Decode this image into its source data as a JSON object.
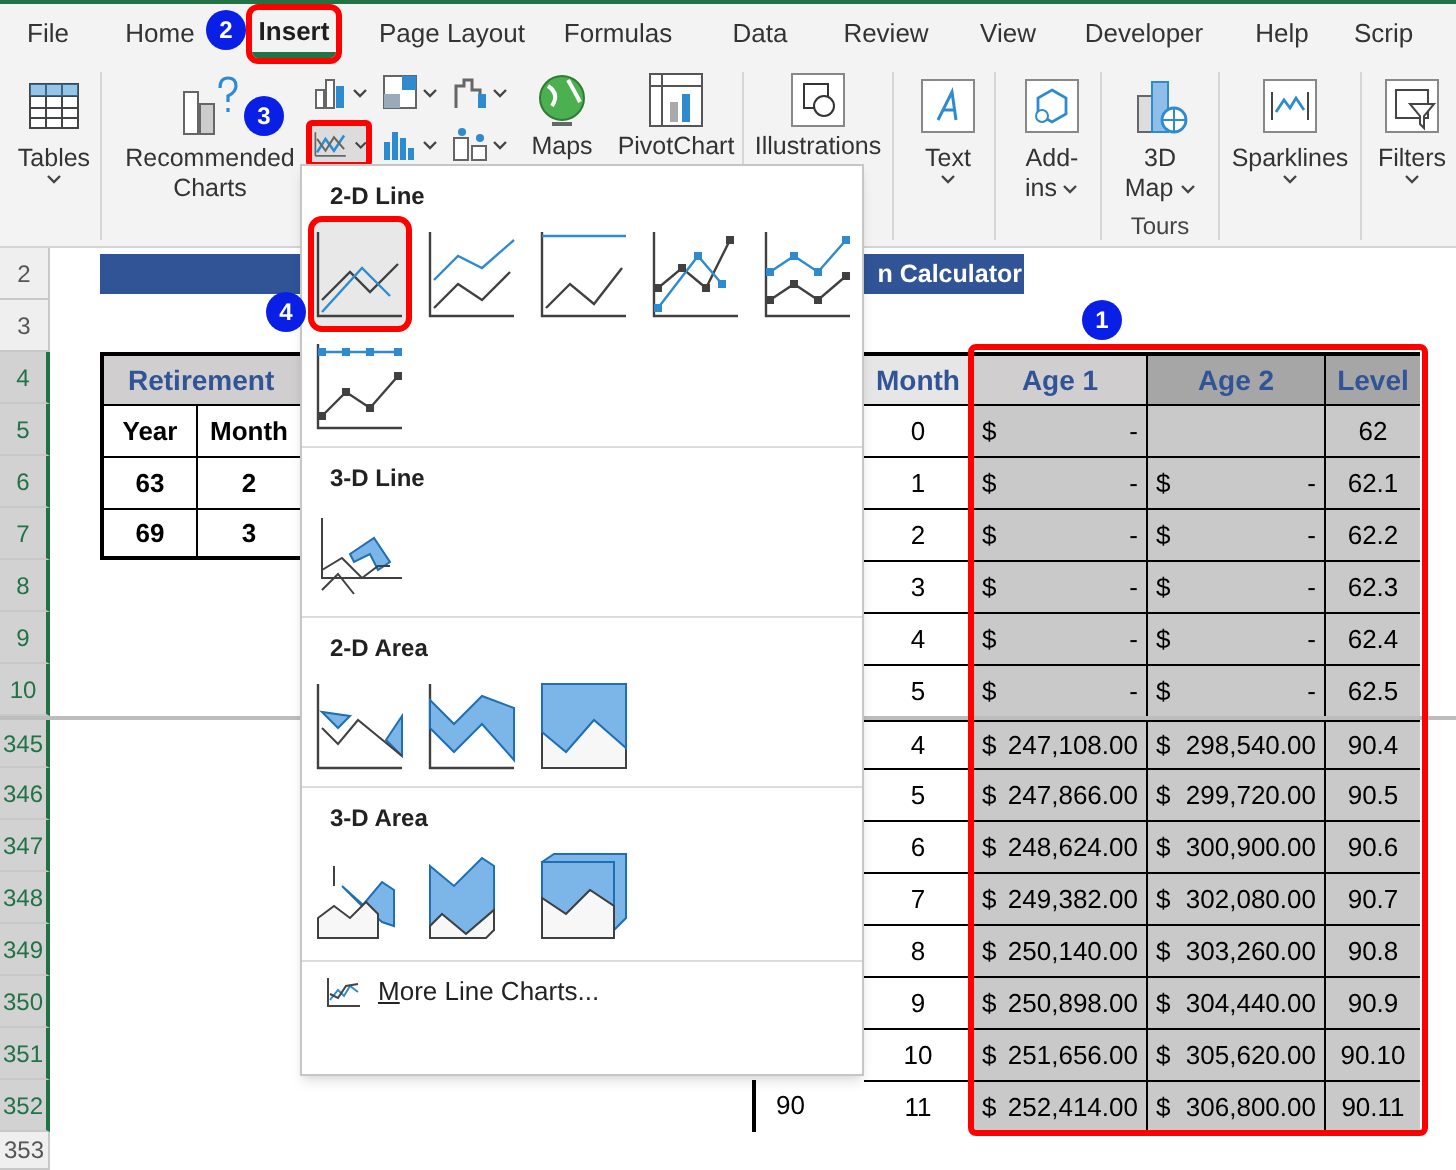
{
  "ribbon_tabs": [
    {
      "label": "File",
      "selected": false,
      "highlighted": false
    },
    {
      "label": "Home",
      "selected": false,
      "highlighted": false
    },
    {
      "label": "Insert",
      "selected": true,
      "highlighted": true
    },
    {
      "label": "Page Layout",
      "selected": false,
      "highlighted": false
    },
    {
      "label": "Formulas",
      "selected": false,
      "highlighted": false
    },
    {
      "label": "Data",
      "selected": false,
      "highlighted": false
    },
    {
      "label": "Review",
      "selected": false,
      "highlighted": false
    },
    {
      "label": "View",
      "selected": false,
      "highlighted": false
    },
    {
      "label": "Developer",
      "selected": false,
      "highlighted": false
    },
    {
      "label": "Help",
      "selected": false,
      "highlighted": false
    },
    {
      "label": "Scrip",
      "selected": false,
      "highlighted": false
    }
  ],
  "ribbon": {
    "tables": {
      "label": "Tables",
      "menu": true
    },
    "recommended_charts": {
      "lines": [
        "Recommended",
        "Charts"
      ]
    },
    "chart_buttons": [
      {
        "highlighted": false
      },
      {
        "highlighted": false
      },
      {
        "highlighted": false
      },
      {
        "highlighted": true
      },
      {
        "highlighted": false
      },
      {
        "highlighted": false
      }
    ],
    "maps": {
      "label": "Maps"
    },
    "pivot_chart": {
      "label": "PivotChart"
    },
    "illustrations": {
      "label": "Illustrations"
    },
    "text": {
      "label": "Text",
      "menu": true
    },
    "add_ins": {
      "lines": [
        "Add-",
        "ins"
      ],
      "menu": true
    },
    "map_3d": {
      "lines": [
        "3D",
        "Map"
      ],
      "menu": true
    },
    "tours_group": "Tours",
    "sparklines": {
      "label": "Sparklines",
      "menu": true
    },
    "filters": {
      "label": "Filters",
      "menu": true
    }
  },
  "sheet": {
    "row_headers": [
      {
        "label": "2",
        "selected": false
      },
      {
        "label": "3",
        "selected": false
      },
      {
        "label": "4",
        "selected": true
      },
      {
        "label": "5",
        "selected": true
      },
      {
        "label": "6",
        "selected": true
      },
      {
        "label": "7",
        "selected": true
      },
      {
        "label": "8",
        "selected": true
      },
      {
        "label": "9",
        "selected": true
      },
      {
        "label": "10",
        "selected": true
      },
      {
        "label": "345",
        "selected": true
      },
      {
        "label": "346",
        "selected": true
      },
      {
        "label": "347",
        "selected": true
      },
      {
        "label": "348",
        "selected": true
      },
      {
        "label": "349",
        "selected": true
      },
      {
        "label": "350",
        "selected": true
      },
      {
        "label": "351",
        "selected": true
      },
      {
        "label": "352",
        "selected": true
      },
      {
        "label": "353",
        "selected": false
      }
    ],
    "title": "n Calculator",
    "left_table": {
      "title": "Retirement",
      "columns": [
        "Year",
        "Month"
      ],
      "rows": [
        [
          "63",
          "2"
        ],
        [
          "69",
          "3"
        ]
      ]
    },
    "right_table": {
      "highlighted": true,
      "columns": [
        "Month",
        "Age 1",
        "Age 2",
        "Level"
      ],
      "rows": [
        {
          "month": "0",
          "age_1": {
            "symbol": "$",
            "amount": "-"
          },
          "level": "62"
        },
        {
          "month": "1",
          "age_1": {
            "symbol": "$",
            "amount": "-"
          },
          "age_2": {
            "symbol": "$",
            "amount": "-"
          },
          "level": "62.1"
        },
        {
          "month": "2",
          "age_1": {
            "symbol": "$",
            "amount": "-"
          },
          "age_2": {
            "symbol": "$",
            "amount": "-"
          },
          "level": "62.2"
        },
        {
          "month": "3",
          "age_1": {
            "symbol": "$",
            "amount": "-"
          },
          "age_2": {
            "symbol": "$",
            "amount": "-"
          },
          "level": "62.3"
        },
        {
          "month": "4",
          "age_1": {
            "symbol": "$",
            "amount": "-"
          },
          "age_2": {
            "symbol": "$",
            "amount": "-"
          },
          "level": "62.4"
        },
        {
          "month": "5",
          "age_1": {
            "symbol": "$",
            "amount": "-"
          },
          "age_2": {
            "symbol": "$",
            "amount": "-"
          },
          "level": "62.5"
        },
        {
          "month": "4",
          "age_1": {
            "symbol": "$",
            "amount": "247,108.00"
          },
          "age_2": {
            "symbol": "$",
            "amount": "298,540.00"
          },
          "level": "90.4"
        },
        {
          "month": "5",
          "age_1": {
            "symbol": "$",
            "amount": "247,866.00"
          },
          "age_2": {
            "symbol": "$",
            "amount": "299,720.00"
          },
          "level": "90.5"
        },
        {
          "month": "6",
          "age_1": {
            "symbol": "$",
            "amount": "248,624.00"
          },
          "age_2": {
            "symbol": "$",
            "amount": "300,900.00"
          },
          "level": "90.6"
        },
        {
          "month": "7",
          "age_1": {
            "symbol": "$",
            "amount": "249,382.00"
          },
          "age_2": {
            "symbol": "$",
            "amount": "302,080.00"
          },
          "level": "90.7"
        },
        {
          "month": "8",
          "age_1": {
            "symbol": "$",
            "amount": "250,140.00"
          },
          "age_2": {
            "symbol": "$",
            "amount": "303,260.00"
          },
          "level": "90.8"
        },
        {
          "month": "9",
          "age_1": {
            "symbol": "$",
            "amount": "250,898.00"
          },
          "age_2": {
            "symbol": "$",
            "amount": "304,440.00"
          },
          "level": "90.9"
        },
        {
          "month": "10",
          "age_1": {
            "symbol": "$",
            "amount": "251,656.00"
          },
          "age_2": {
            "symbol": "$",
            "amount": "305,620.00"
          },
          "level": "90.10"
        },
        {
          "month": "11",
          "age_1": {
            "symbol": "$",
            "amount": "252,414.00"
          },
          "age_2": {
            "symbol": "$",
            "amount": "306,800.00"
          },
          "level": "90.11"
        }
      ]
    },
    "stray_cell": "90"
  },
  "chart_menu": {
    "sections": [
      {
        "title": "2-D Line",
        "options": [
          {
            "kind": "line",
            "selected": true
          },
          {
            "kind": "stacked-line",
            "selected": false
          },
          {
            "kind": "pct-line",
            "selected": false
          },
          {
            "kind": "line-markers",
            "selected": false
          },
          {
            "kind": "stacked-markers",
            "selected": false
          },
          {
            "kind": "pct-markers",
            "selected": false
          }
        ]
      },
      {
        "title": "3-D Line",
        "options": [
          {
            "kind": "line3d",
            "selected": false
          }
        ]
      },
      {
        "title": "2-D Area",
        "options": [
          {
            "kind": "area",
            "selected": false
          },
          {
            "kind": "stacked-area",
            "selected": false
          },
          {
            "kind": "pct-area",
            "selected": false
          }
        ]
      },
      {
        "title": "3-D Area",
        "options": [
          {
            "kind": "area3d",
            "selected": false
          },
          {
            "kind": "stackedarea3d",
            "selected": false
          },
          {
            "kind": "pctarea3d",
            "selected": false
          }
        ]
      }
    ],
    "more": {
      "label": "More Line Charts..."
    }
  },
  "badges": [
    "1",
    "2",
    "3",
    "4"
  ]
}
